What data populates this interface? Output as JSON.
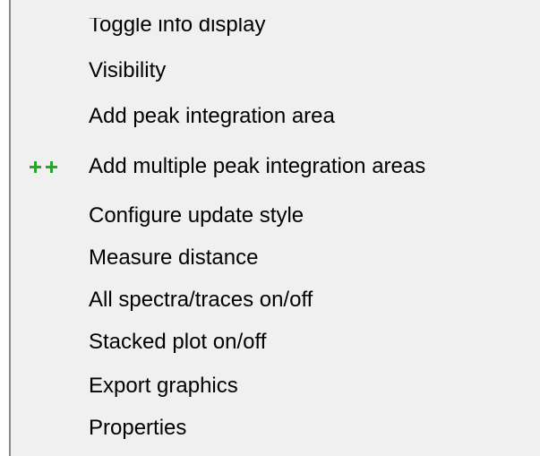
{
  "menu": {
    "items": [
      {
        "label": "Toggle info display",
        "icon": null,
        "partially_visible": true
      },
      {
        "label": "Visibility",
        "icon": null
      },
      {
        "label": "Add peak integration area",
        "icon": null
      },
      {
        "label": "Add multiple peak integration areas",
        "icon": "plus-plus-icon",
        "icon_color": "#2aa52a"
      },
      {
        "label": "Configure update style",
        "icon": null
      },
      {
        "label": "Measure distance",
        "icon": null
      },
      {
        "label": "All spectra/traces on/off",
        "icon": null
      },
      {
        "label": "Stacked plot on/off",
        "icon": null
      },
      {
        "label": "Export graphics",
        "icon": null
      },
      {
        "label": "Properties",
        "icon": null
      }
    ]
  },
  "colors": {
    "menu_background": "#f0f0f0",
    "menu_border": "#8a8a8a",
    "text": "#000000",
    "icon_green": "#2aa52a"
  }
}
